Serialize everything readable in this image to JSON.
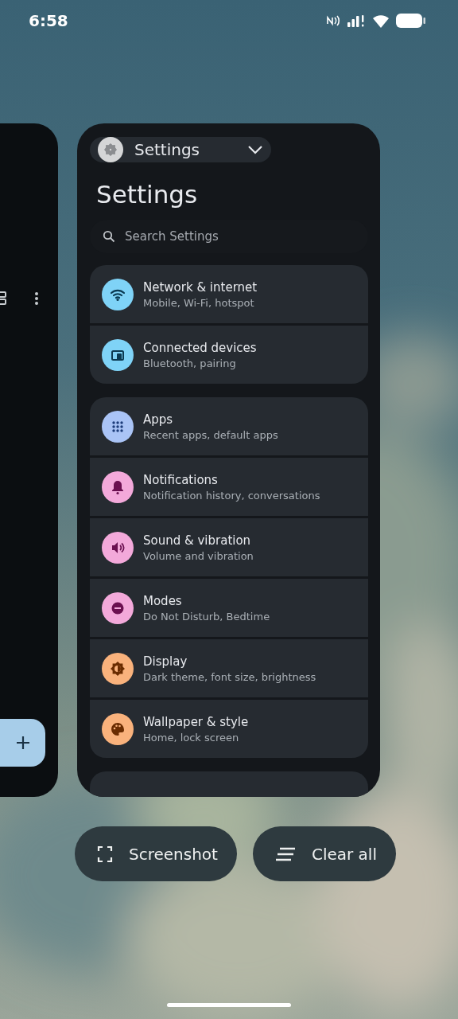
{
  "status_bar": {
    "time": "6:58"
  },
  "settings_card": {
    "app_chip": {
      "label": "Settings"
    },
    "title": "Settings",
    "search": {
      "placeholder": "Search Settings"
    },
    "groups": [
      {
        "items": [
          {
            "title": "Network & internet",
            "subtitle": "Mobile, Wi‑Fi, hotspot",
            "color": "#7fd3f7"
          },
          {
            "title": "Connected devices",
            "subtitle": "Bluetooth, pairing",
            "color": "#7fd3f7"
          }
        ]
      },
      {
        "items": [
          {
            "title": "Apps",
            "subtitle": "Recent apps, default apps",
            "color": "#aac4f6"
          },
          {
            "title": "Notifications",
            "subtitle": "Notification history, conversations",
            "color": "#f3a9da"
          },
          {
            "title": "Sound & vibration",
            "subtitle": "Volume and vibration",
            "color": "#f3a9da"
          },
          {
            "title": "Modes",
            "subtitle": "Do Not Disturb, Bedtime",
            "color": "#f3a9da"
          },
          {
            "title": "Display",
            "subtitle": "Dark theme, font size, brightness",
            "color": "#f9b27c"
          },
          {
            "title": "Wallpaper & style",
            "subtitle": "Home, lock screen",
            "color": "#f9b27c"
          }
        ]
      }
    ]
  },
  "actions": [
    {
      "label": "Screenshot"
    },
    {
      "label": "Clear all"
    }
  ]
}
